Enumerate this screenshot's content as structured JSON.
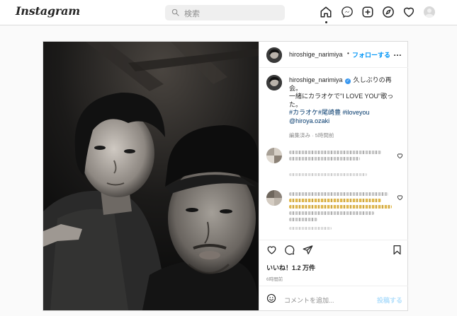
{
  "app": {
    "logo": "Instagram"
  },
  "search": {
    "placeholder": "検索"
  },
  "nav": {
    "icons": [
      "home-icon",
      "messenger-icon",
      "new-post-icon",
      "explore-icon",
      "activity-heart-icon",
      "profile-avatar"
    ]
  },
  "post": {
    "author": "hiroshige_narimiya",
    "separator": "•",
    "follow_label": "フォローする",
    "more_label": "…",
    "caption": {
      "username": "hiroshige_narimiya",
      "line1": "久しぶりの再会。",
      "line2": "一緒にカラオケで\"I LOVE YOU\"歌った。",
      "hashtags": "#カラオケ#尾崎豊 #iloveyou",
      "mention": "@hiroya.ozaki"
    },
    "meta": "編集済み · 5時間前",
    "likes_label": "いいね！1.2 万件",
    "time_ago": "6時間前",
    "comment_placeholder": "コメントを追加...",
    "post_label": "投稿する"
  },
  "colors": {
    "accent": "#0095f6",
    "link": "#00376b",
    "muted": "#8e8e8e",
    "border": "#dbdbdb"
  }
}
